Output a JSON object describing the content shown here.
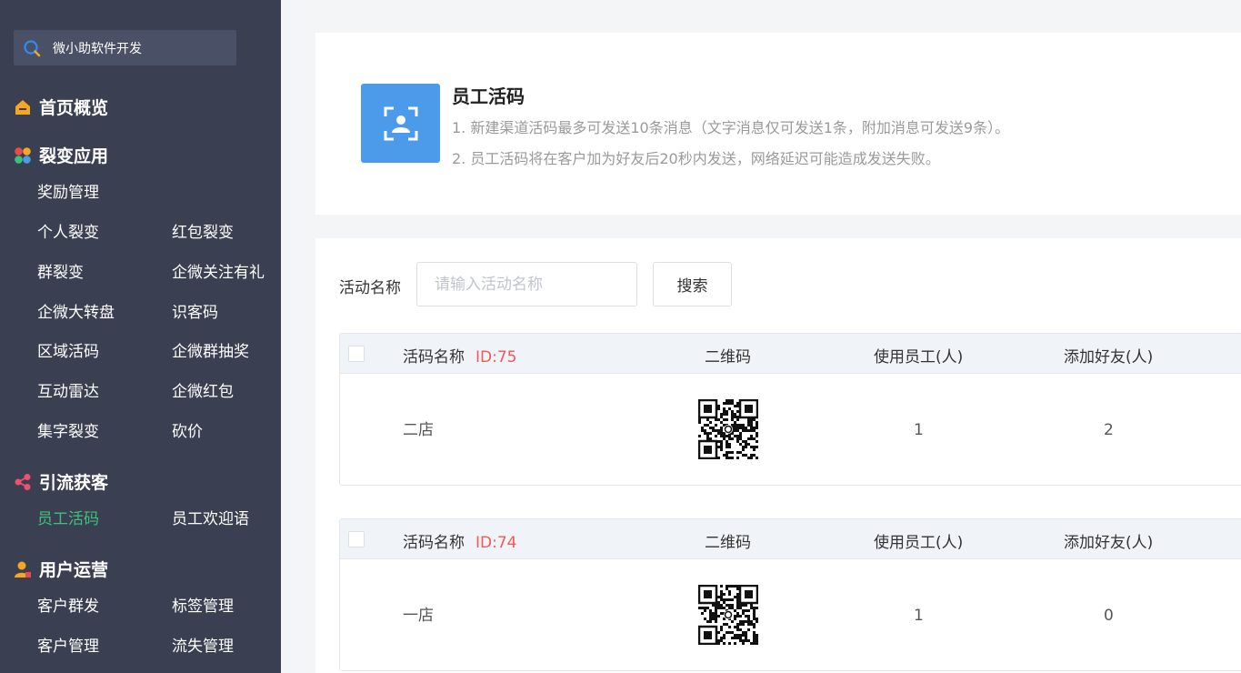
{
  "brand": {
    "name": "微小助软件开发",
    "icon": "brand-search-icon"
  },
  "sidebar": {
    "sections": [
      {
        "title": "首页概览",
        "icon": "home-icon",
        "color": "#f5a623"
      },
      {
        "title": "裂变应用",
        "icon": "apps-icon",
        "color": "#e94b4b"
      },
      {
        "title": "引流获客",
        "icon": "share-icon",
        "color": "#f0506e"
      },
      {
        "title": "用户运营",
        "icon": "user-icon",
        "color": "#f5a623"
      }
    ],
    "items": {
      "reward": "奖励管理",
      "personal": "个人裂变",
      "redpacket": "红包裂变",
      "group": "群裂变",
      "follow": "企微关注有礼",
      "wheel": "企微大转盘",
      "idcode": "识客码",
      "region": "区域活码",
      "grouplottery": "企微群抽奖",
      "radar": "互动雷达",
      "wecomred": "企微红包",
      "collect": "集字裂变",
      "bargain": "砍价",
      "staffcode": "员工活码",
      "welcome": "员工欢迎语",
      "broadcast": "客户群发",
      "tags": "标签管理",
      "customers": "客户管理",
      "churn": "流失管理"
    },
    "active_color": "#3ec27a"
  },
  "header": {
    "title": "员工活码",
    "lines": [
      "1. 新建渠道活码最多可发送10条消息（文字消息仅可发送1条，附加消息可发送9条）。",
      "2. 员工活码将在客户加为好友后20秒内发送，网络延迟可能造成发送失败。"
    ],
    "icon": "scan-user-icon"
  },
  "search": {
    "label": "活动名称",
    "placeholder": "请输入活动名称",
    "value": "",
    "button": "搜索"
  },
  "columns": {
    "name": "活码名称",
    "qr": "二维码",
    "staff": "使用员工(人)",
    "friends": "添加好友(人)"
  },
  "codes": [
    {
      "id": "ID:75",
      "name": "二店",
      "staff": "1",
      "friends": "2"
    },
    {
      "id": "ID:74",
      "name": "一店",
      "staff": "1",
      "friends": "0"
    }
  ]
}
